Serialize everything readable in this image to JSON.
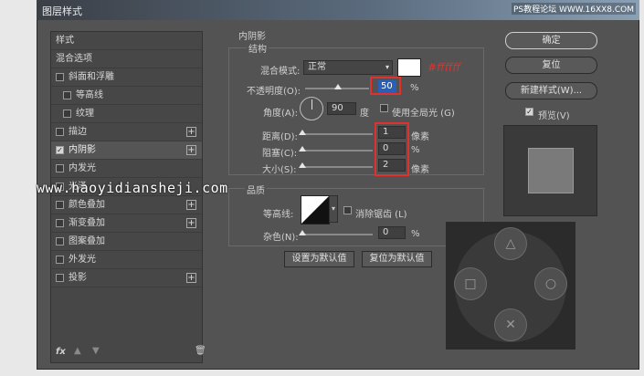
{
  "dialog_title": "图层样式",
  "watermark_top": "PS教程论坛 WWW.16XX8.COM",
  "watermark_mid": "www.haoyidiansheji.com",
  "left_panel": {
    "items": [
      {
        "label": "样式"
      },
      {
        "label": "混合选项"
      },
      {
        "label": "斜面和浮雕"
      },
      {
        "label": "等高线"
      },
      {
        "label": "纹理"
      },
      {
        "label": "描边"
      },
      {
        "label": "内阴影"
      },
      {
        "label": "内发光"
      },
      {
        "label": "光泽"
      },
      {
        "label": "颜色叠加"
      },
      {
        "label": "渐变叠加"
      },
      {
        "label": "图案叠加"
      },
      {
        "label": "外发光"
      },
      {
        "label": "投影"
      }
    ],
    "fx_label": "fx"
  },
  "inner_shadow": {
    "section_title": "内阴影",
    "structure_title": "结构",
    "blend_mode_label": "混合模式:",
    "blend_mode_value": "正常",
    "color_annotation": "#ffffff",
    "opacity_label": "不透明度(O):",
    "opacity_value": "50",
    "opacity_unit": "%",
    "angle_label": "角度(A):",
    "angle_value": "90",
    "angle_unit": "度",
    "global_light_label": "使用全局光 (G)",
    "distance_label": "距离(D):",
    "distance_value": "1",
    "distance_unit": "像素",
    "choke_label": "阻塞(C):",
    "choke_value": "0",
    "choke_unit": "%",
    "size_label": "大小(S):",
    "size_value": "2",
    "size_unit": "像素",
    "quality_title": "品质",
    "contour_label": "等高线:",
    "antialias_label": "消除锯齿 (L)",
    "noise_label": "杂色(N):",
    "noise_value": "0",
    "noise_unit": "%",
    "set_default_label": "设置为默认值",
    "reset_default_label": "复位为默认值"
  },
  "right_panel": {
    "ok_label": "确定",
    "reset_label": "复位",
    "new_style_label": "新建样式(W)...",
    "preview_label": "预览(V)"
  },
  "colors": {
    "annotation_red": "#e0312f",
    "dialog_bg": "#535353",
    "swatch": "#ffffff"
  }
}
